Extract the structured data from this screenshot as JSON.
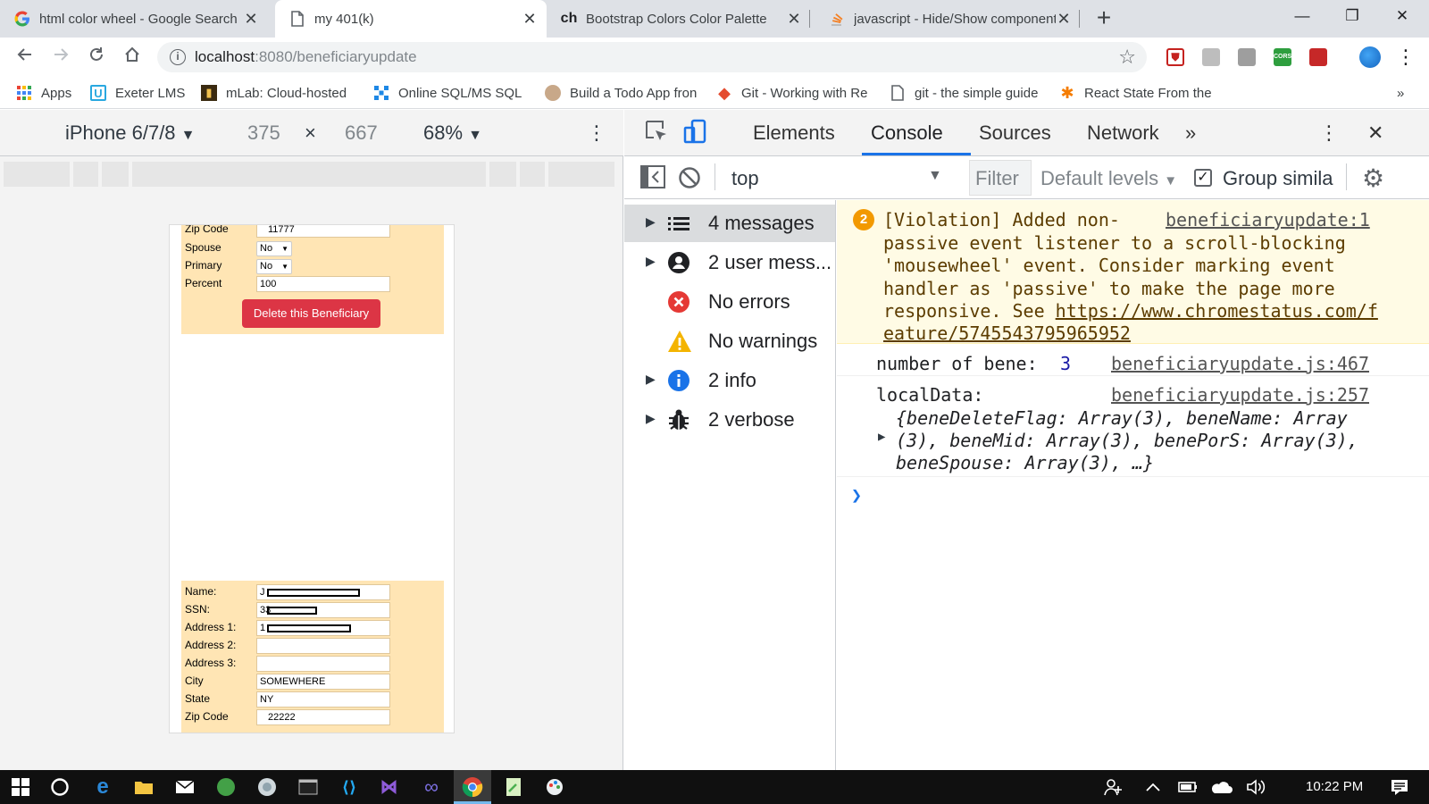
{
  "browser": {
    "tabs": [
      {
        "title": "html color wheel - Google Search",
        "active": false,
        "icon": "google-g-icon"
      },
      {
        "title": "my 401(k)",
        "active": true,
        "icon": "document-icon"
      },
      {
        "title": "Bootstrap Colors Color Palette",
        "active": false,
        "icon": "ch-text-icon"
      },
      {
        "title": "javascript - Hide/Show components",
        "active": false,
        "icon": "stackoverflow-icon"
      }
    ],
    "favicon_ch": "ch",
    "new_tab": "+",
    "window_controls": {
      "minimize": "—",
      "restore": "❐",
      "close": "✕"
    },
    "url_host": "localhost",
    "url_path": ":8080/beneficiaryupdate",
    "bookmarks": [
      "Apps",
      "Exeter LMS",
      "mLab: Cloud-hosted",
      "Online SQL/MS SQL i",
      "Build a Todo App fron",
      "Git - Working with Re",
      "git - the simple guide",
      "React State From the"
    ],
    "bookmark_icon_letters": {
      "exeter": "U",
      "git": "◆"
    },
    "bookmarks_overflow": "»",
    "extensions": {
      "cors_label": "CORS"
    }
  },
  "device_toolbar": {
    "device": "iPhone 6/7/8",
    "width": "375",
    "times": "×",
    "height": "667",
    "zoom": "68%",
    "dropdown_arrow": "▼",
    "more": "⋮"
  },
  "form_top": {
    "zip_label": "Zip Code",
    "zip_value": "11777",
    "spouse_label": "Spouse",
    "spouse_value": "No",
    "primary_label": "Primary",
    "primary_value": "No",
    "percent_label": "Percent",
    "percent_value": "100",
    "delete_label": "Delete this Beneficiary",
    "select_arrow": "▼"
  },
  "form_bottom": {
    "name_label": "Name:",
    "name_value": "J",
    "ssn_label": "SSN:",
    "ssn_value": "33",
    "addr1_label": "Address 1:",
    "addr1_value": "1",
    "addr2_label": "Address 2:",
    "addr2_value": "",
    "addr3_label": "Address 3:",
    "addr3_value": "",
    "city_label": "City",
    "city_value": "SOMEWHERE",
    "state_label": "State",
    "state_value": "NY",
    "zip_label": "Zip Code",
    "zip_value": "22222"
  },
  "devtools": {
    "tabs": [
      "Elements",
      "Console",
      "Sources",
      "Network"
    ],
    "active_tab": "Console",
    "more_tabs": "»",
    "menu": "⋮",
    "close": "✕",
    "context": "top",
    "filter_placeholder": "Filter",
    "levels": "Default levels",
    "group_similar": "Group simila",
    "group_similar_checked": true
  },
  "sidebar": {
    "items": [
      {
        "label": "4 messages",
        "icon": "list-icon",
        "expandable": true
      },
      {
        "label": "2 user mess...",
        "icon": "user-icon",
        "expandable": true
      },
      {
        "label": "No errors",
        "icon": "error-icon",
        "expandable": false
      },
      {
        "label": "No warnings",
        "icon": "warning-icon",
        "expandable": false
      },
      {
        "label": "2 info",
        "icon": "info-icon",
        "expandable": true
      },
      {
        "label": "2 verbose",
        "icon": "bug-icon",
        "expandable": true
      }
    ]
  },
  "console": {
    "violation": {
      "count": "2",
      "lines": [
        "[Violation] Added non-",
        "passive event listener to a scroll-blocking",
        "'mousewheel' event. Consider marking event",
        "handler as 'passive' to make the page more",
        "responsive. See "
      ],
      "url_line1": "https://www.chromestatus.com/f",
      "url_line2": "eature/5745543795965952",
      "source": "beneficiaryupdate:1"
    },
    "log1": {
      "text": "number of bene:",
      "value": "3",
      "source": "beneficiaryupdate.js:467"
    },
    "log2": {
      "text": "localData:",
      "source": "beneficiaryupdate.js:257",
      "line1": "{beneDeleteFlag: Array(3), beneName: Array",
      "line2": "(3), beneMid: Array(3), benePorS: Array(3),",
      "line3": "beneSpouse: Array(3), …}"
    },
    "prompt": "❯"
  },
  "taskbar": {
    "time": "10:22 PM"
  },
  "colors": {
    "accent": "#1a73e8",
    "delete_button": "#dc3545",
    "form_bg": "#ffe5b4",
    "violation_bg": "#fffbe5"
  }
}
